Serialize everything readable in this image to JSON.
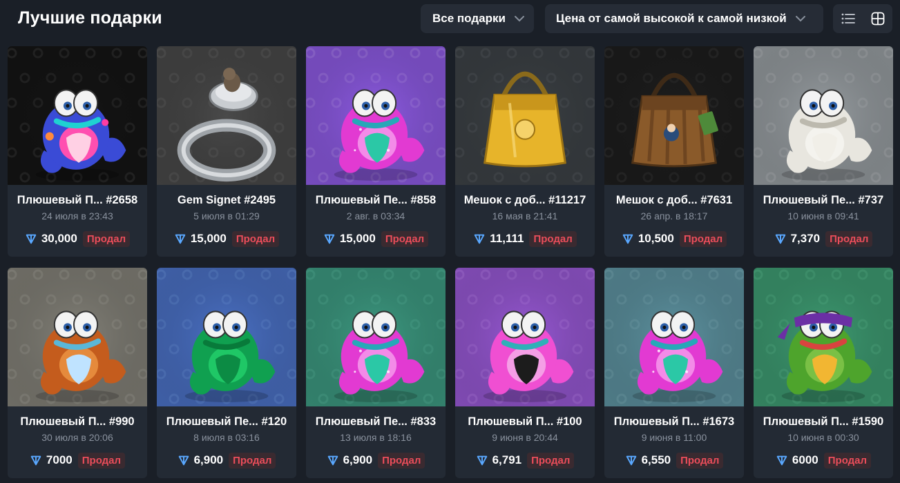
{
  "header": {
    "title": "Лучшие подарки",
    "filter_label": "Все подарки",
    "sort_label": "Цена от самой высокой к самой низкой"
  },
  "sold_label": "Продал",
  "cards": [
    {
      "name": "Плюшевый П...",
      "number": "#2658",
      "date": "24 июля в 23:43",
      "price": "30,000",
      "bg": "#151515",
      "pattern": "#2a2a2a",
      "art": "pepe-neon"
    },
    {
      "name": "Gem Signet",
      "number": "#2495",
      "date": "5 июля в 01:29",
      "price": "15,000",
      "bg": "#4a4a4a",
      "pattern": "#585858",
      "art": "ring"
    },
    {
      "name": "Плюшевый Пе...",
      "number": "#858",
      "date": "2 авг. в 03:34",
      "price": "15,000",
      "bg": "#8f5ce6",
      "pattern": "#a274ee",
      "art": "pepe-pink"
    },
    {
      "name": "Мешок с доб...",
      "number": "#11217",
      "date": "16 мая в 21:41",
      "price": "11,111",
      "bg": "#3e4347",
      "pattern": "#4b5055",
      "art": "bag-gold"
    },
    {
      "name": "Мешок с доб...",
      "number": "#7631",
      "date": "26 апр. в 18:17",
      "price": "10,500",
      "bg": "#1e1e1e",
      "pattern": "#2c2c2c",
      "art": "bag-brown"
    },
    {
      "name": "Плюшевый Пе...",
      "number": "#737",
      "date": "10 июня в 09:41",
      "price": "7,370",
      "bg": "#9aa0a4",
      "pattern": "#a9aeb2",
      "art": "pepe-white"
    },
    {
      "name": "Плюшевый П...",
      "number": "#990",
      "date": "30 июля в 20:06",
      "price": "7000",
      "bg": "#85837a",
      "pattern": "#95938a",
      "art": "pepe-orange"
    },
    {
      "name": "Плюшевый Пе...",
      "number": "#120",
      "date": "8 июля в 03:16",
      "price": "6,900",
      "bg": "#4c73c9",
      "pattern": "#5b84d6",
      "art": "pepe-green"
    },
    {
      "name": "Плюшевый Пе...",
      "number": "#833",
      "date": "13 июля в 18:16",
      "price": "6,900",
      "bg": "#3e9c83",
      "pattern": "#4aab91",
      "art": "pepe-pink"
    },
    {
      "name": "Плюшевый П...",
      "number": "#100",
      "date": "9 июня в 20:44",
      "price": "6,791",
      "bg": "#9a5ad8",
      "pattern": "#aa6ce4",
      "art": "pepe-magenta"
    },
    {
      "name": "Плюшевый П...",
      "number": "#1673",
      "date": "9 июня в 11:00",
      "price": "6,550",
      "bg": "#5f95a3",
      "pattern": "#6ea3b0",
      "art": "pepe-pink"
    },
    {
      "name": "Плюшевый П...",
      "number": "#1590",
      "date": "10 июня в 00:30",
      "price": "6000",
      "bg": "#3f9e74",
      "pattern": "#4cae82",
      "art": "pepe-ninja"
    }
  ]
}
